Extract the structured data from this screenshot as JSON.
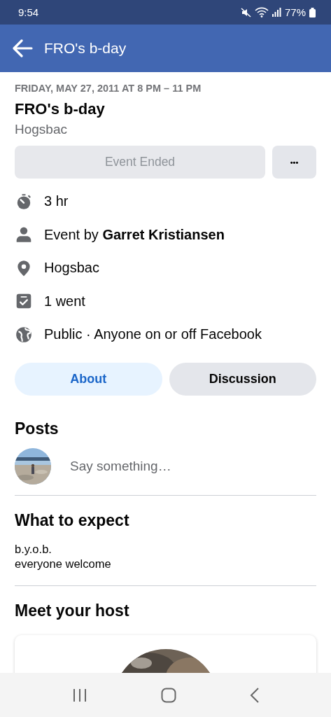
{
  "status_bar": {
    "time": "9:54",
    "battery": "77%"
  },
  "app_bar": {
    "title": "FRO's b-day"
  },
  "event": {
    "date": "FRIDAY, MAY 27, 2011 AT 8 PM – 11 PM",
    "title": "FRO's b-day",
    "place": "Hogsbac",
    "status_button": {
      "label": "Event Ended",
      "disabled": true
    },
    "more_button": {
      "label": "•••"
    }
  },
  "details": [
    {
      "kind": "duration",
      "text": "3 hr"
    },
    {
      "kind": "host",
      "text": "Event by **Garret Kristiansen**"
    },
    {
      "kind": "location",
      "text": "Hogsbac"
    },
    {
      "kind": "going",
      "text": "1 went"
    },
    {
      "kind": "privacy",
      "text": "Public · Anyone on or off Facebook"
    }
  ],
  "tabs": [
    {
      "label": "About",
      "selected": true
    },
    {
      "label": "Discussion",
      "selected": false
    }
  ],
  "posts": {
    "heading": "Posts",
    "composer": {
      "placeholder": "Say something…"
    }
  },
  "what_to_expect": {
    "heading": "What to expect",
    "lines": [
      "b.y.o.b.",
      "everyone welcome"
    ]
  },
  "host_section": {
    "heading": "Meet your host"
  }
}
